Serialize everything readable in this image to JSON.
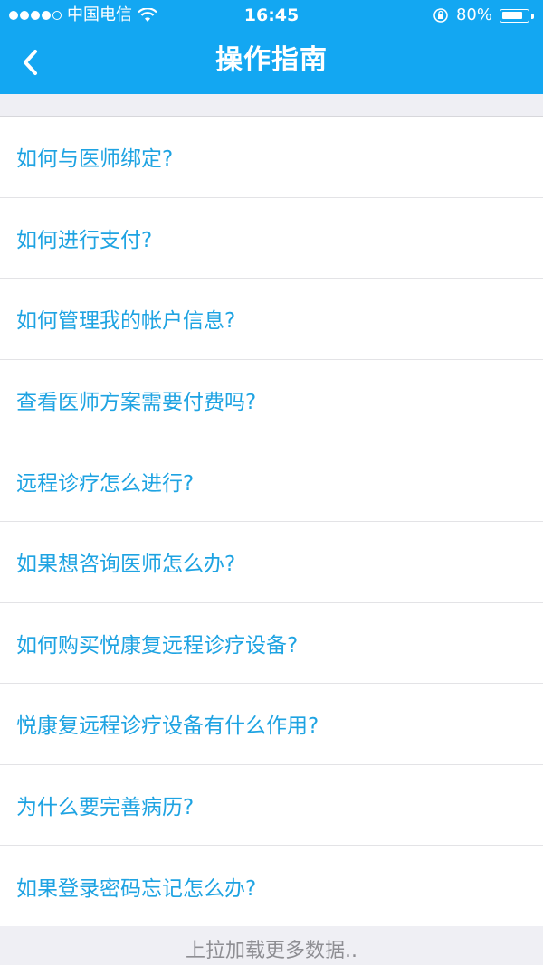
{
  "status_bar": {
    "carrier": "中国电信",
    "time": "16:45",
    "battery_percent": "80%",
    "battery_level": 0.8,
    "icons": [
      "signal-dots-icon",
      "wifi-icon",
      "orientation-lock-icon",
      "battery-icon"
    ]
  },
  "nav": {
    "title": "操作指南",
    "back_icon": "chevron-left-icon"
  },
  "colors": {
    "header_bg": "#13a7f2",
    "link_text": "#1ea3e2",
    "page_bg": "#efeff4"
  },
  "items": [
    {
      "label": "如何与医师绑定?"
    },
    {
      "label": "如何进行支付?"
    },
    {
      "label": "如何管理我的帐户信息?"
    },
    {
      "label": "查看医师方案需要付费吗?"
    },
    {
      "label": "远程诊疗怎么进行?"
    },
    {
      "label": "如果想咨询医师怎么办?"
    },
    {
      "label": "如何购买悦康复远程诊疗设备?"
    },
    {
      "label": "悦康复远程诊疗设备有什么作用?"
    },
    {
      "label": "为什么要完善病历?"
    },
    {
      "label": "如果登录密码忘记怎么办?"
    }
  ],
  "footer": {
    "load_more": "上拉加载更多数据.."
  }
}
